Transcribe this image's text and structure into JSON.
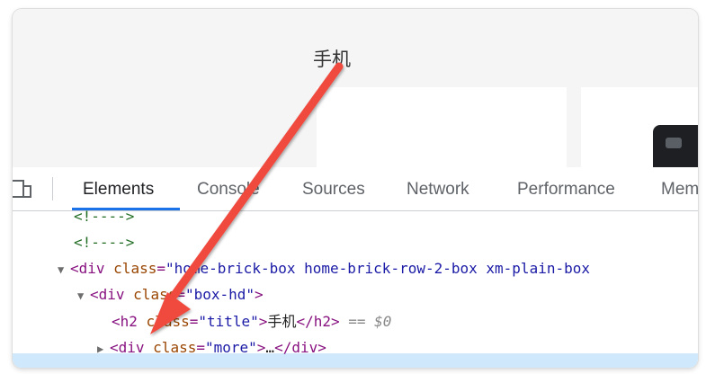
{
  "page": {
    "section_title": "手机"
  },
  "devtools": {
    "tabs": [
      "Elements",
      "Console",
      "Sources",
      "Network",
      "Performance",
      "Mem"
    ],
    "active_tab": "Elements",
    "dom_lines": {
      "l1": {
        "comment": "<!---->"
      },
      "l2": {
        "comment": "<!---->"
      },
      "l3": {
        "open": "<div",
        "attr": "class",
        "value": "\"home-brick-box home-brick-row-2-box xm-plain-box"
      },
      "l4": {
        "open": "<div",
        "attr": "class",
        "value": "\"box-hd\"",
        "close": ">"
      },
      "l5": {
        "open": "<h2",
        "attr": "class",
        "value": "\"title\"",
        "gt": ">",
        "text": "手机",
        "end": "</h2>",
        "console_ref": "== $0"
      },
      "l6": {
        "open": "<div",
        "attr": "class",
        "value": "\"more\"",
        "gt": ">",
        "text": "…",
        "end": "</div>"
      }
    }
  },
  "colors": {
    "annotation_arrow": "#f0483e",
    "selected_row": "#cfe8fc",
    "active_tab_underline": "#1a73e8"
  },
  "icons": [
    "device-toolbar-icon",
    "expand-triangle-icon",
    "collapse-triangle-icon",
    "annotation-arrow"
  ]
}
